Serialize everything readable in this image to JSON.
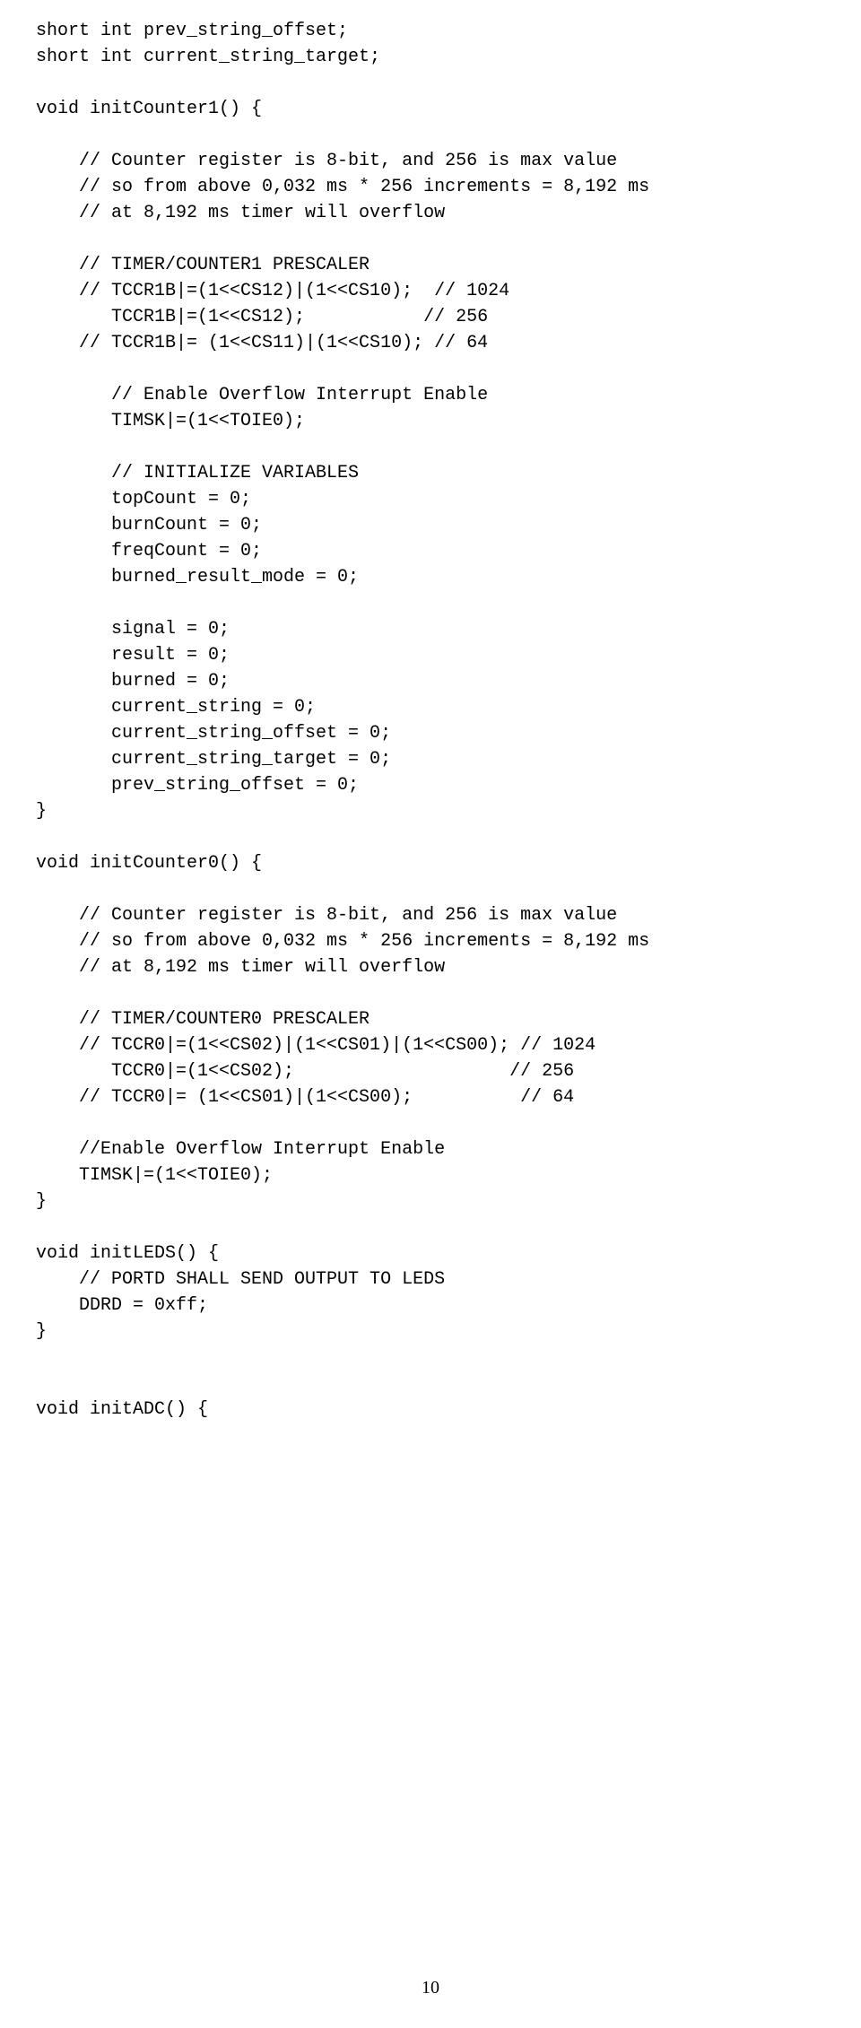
{
  "page_number": "10",
  "code_lines": [
    "short int prev_string_offset;",
    "short int current_string_target;",
    "",
    "void initCounter1() {",
    "",
    "    // Counter register is 8-bit, and 256 is max value",
    "    // so from above 0,032 ms * 256 increments = 8,192 ms",
    "    // at 8,192 ms timer will overflow",
    "",
    "    // TIMER/COUNTER1 PRESCALER",
    "    // TCCR1B|=(1<<CS12)|(1<<CS10);  // 1024",
    "       TCCR1B|=(1<<CS12);           // 256",
    "    // TCCR1B|= (1<<CS11)|(1<<CS10); // 64",
    "",
    "       // Enable Overflow Interrupt Enable",
    "       TIMSK|=(1<<TOIE0);",
    "",
    "       // INITIALIZE VARIABLES",
    "       topCount = 0;",
    "       burnCount = 0;",
    "       freqCount = 0;",
    "       burned_result_mode = 0;",
    "",
    "       signal = 0;",
    "       result = 0;",
    "       burned = 0;",
    "       current_string = 0;",
    "       current_string_offset = 0;",
    "       current_string_target = 0;",
    "       prev_string_offset = 0;",
    "}",
    "",
    "void initCounter0() {",
    "",
    "    // Counter register is 8-bit, and 256 is max value",
    "    // so from above 0,032 ms * 256 increments = 8,192 ms",
    "    // at 8,192 ms timer will overflow",
    "",
    "    // TIMER/COUNTER0 PRESCALER",
    "    // TCCR0|=(1<<CS02)|(1<<CS01)|(1<<CS00); // 1024",
    "       TCCR0|=(1<<CS02);                    // 256",
    "    // TCCR0|= (1<<CS01)|(1<<CS00);          // 64",
    "",
    "    //Enable Overflow Interrupt Enable",
    "    TIMSK|=(1<<TOIE0);",
    "}",
    "",
    "void initLEDS() {",
    "    // PORTD SHALL SEND OUTPUT TO LEDS",
    "    DDRD = 0xff;",
    "}",
    "",
    "",
    "void initADC() {"
  ]
}
